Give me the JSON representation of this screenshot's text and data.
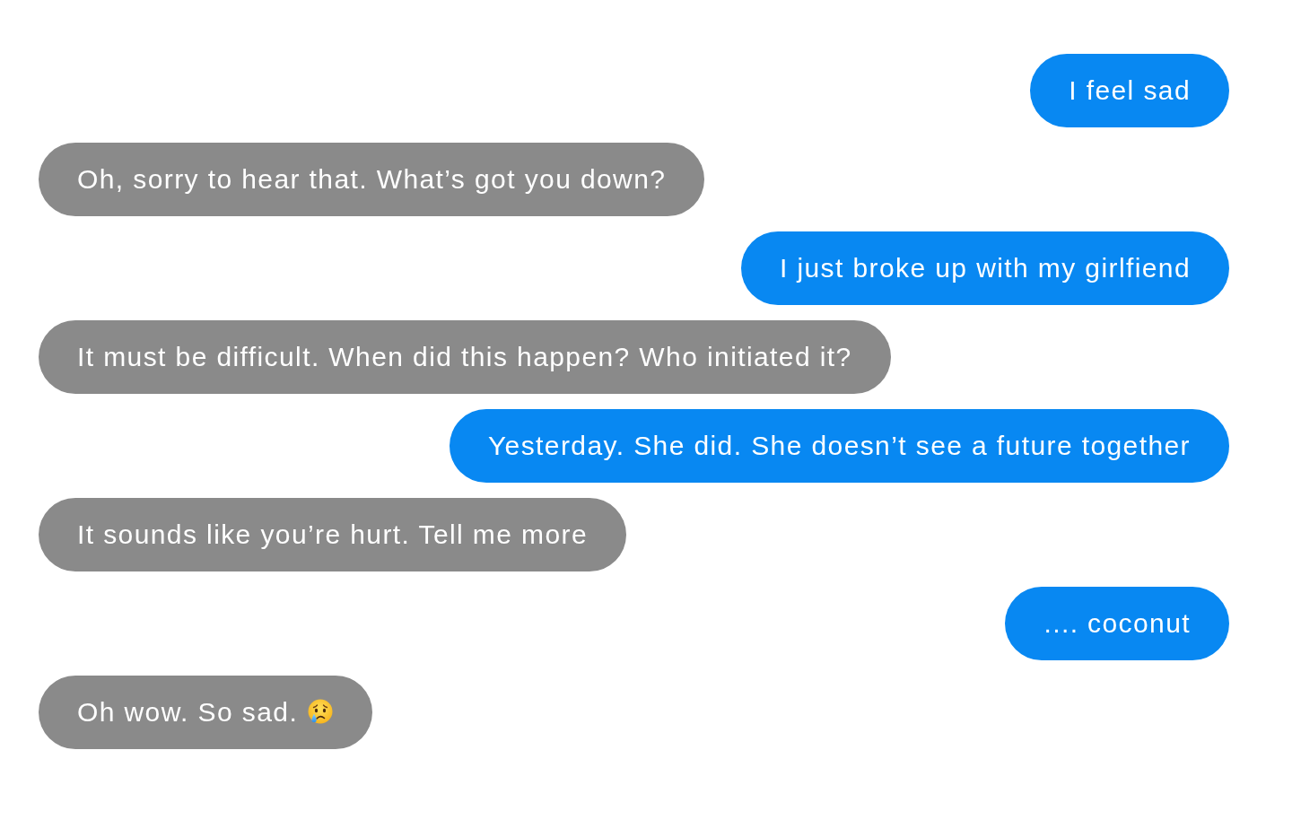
{
  "messages": [
    {
      "kind": "sent",
      "text": "I feel sad",
      "emoji": false
    },
    {
      "kind": "received",
      "text": "Oh, sorry to hear that. What’s got you down?",
      "emoji": false
    },
    {
      "kind": "sent",
      "text": "I just broke up with my girlfiend",
      "emoji": false
    },
    {
      "kind": "received",
      "text": "It must be difficult. When did this happen? Who initiated it?",
      "emoji": false
    },
    {
      "kind": "sent",
      "text": "Yesterday. She did. She doesn’t see a future together",
      "emoji": false
    },
    {
      "kind": "received",
      "text": "It sounds like you’re hurt. Tell me more",
      "emoji": false
    },
    {
      "kind": "sent",
      "text": ".... coconut",
      "emoji": false
    },
    {
      "kind": "received",
      "text": "Oh wow. So sad.",
      "emoji": true
    }
  ]
}
